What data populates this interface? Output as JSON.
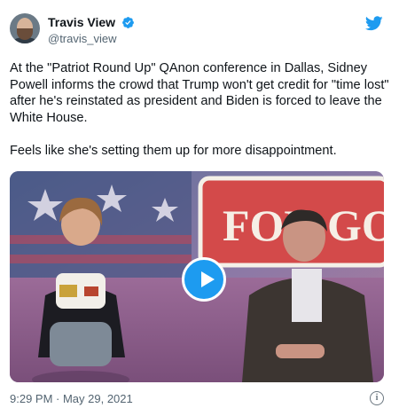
{
  "tweet": {
    "author_name": "Travis View",
    "author_handle": "@travis_view",
    "verified": true,
    "text_paragraph_1": "At the \"Patriot Round Up\" QAnon conference in Dallas, Sidney Powell informs the crowd that Trump won't get credit for \"time lost\" after he's reinstated as president and Biden is forced to leave the White House.",
    "text_paragraph_2": "Feels like she's setting them up for more disappointment.",
    "media_sign_text": "FOR GOD",
    "timestamp": "9:29 PM · May 29, 2021",
    "info_glyph": "i"
  },
  "icons": {
    "avatar": "avatar",
    "verified": "verified-badge-icon",
    "brand": "twitter-bird-icon",
    "play": "play-icon",
    "info": "info-icon"
  },
  "colors": {
    "accent": "#1d9bf0",
    "secondary_text": "#536471"
  }
}
